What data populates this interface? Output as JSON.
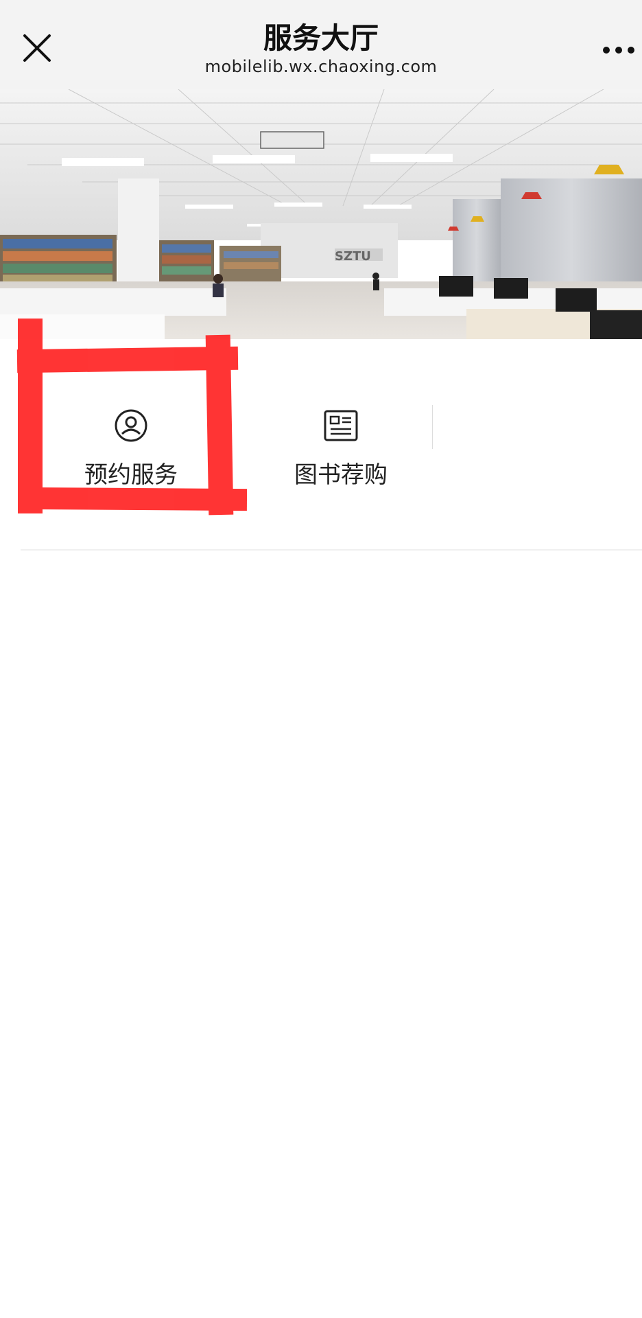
{
  "header": {
    "title": "服务大厅",
    "url": "mobilelib.wx.chaoxing.com",
    "close_icon": "close-icon",
    "more_icon": "more-dots-icon"
  },
  "banner": {
    "image": "library-reading-room-photo",
    "sign_text": "SZTU"
  },
  "services": [
    {
      "label": "预约服务",
      "icon": "user-circle-icon"
    },
    {
      "label": "图书荐购",
      "icon": "book-card-icon"
    }
  ],
  "highlight": {
    "target": "预约服务",
    "color": "#ff2a2a"
  }
}
